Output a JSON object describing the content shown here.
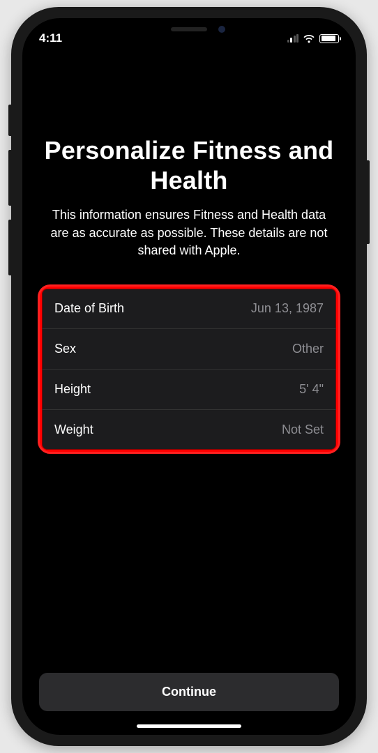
{
  "status": {
    "time": "4:11"
  },
  "page": {
    "title": "Personalize Fitness and Health",
    "description": "This information ensures Fitness and Health data are as accurate as possible. These details are not shared with Apple."
  },
  "settings": {
    "rows": [
      {
        "label": "Date of Birth",
        "value": "Jun 13, 1987"
      },
      {
        "label": "Sex",
        "value": "Other"
      },
      {
        "label": "Height",
        "value": "5' 4\""
      },
      {
        "label": "Weight",
        "value": "Not Set"
      }
    ]
  },
  "actions": {
    "continue": "Continue"
  }
}
